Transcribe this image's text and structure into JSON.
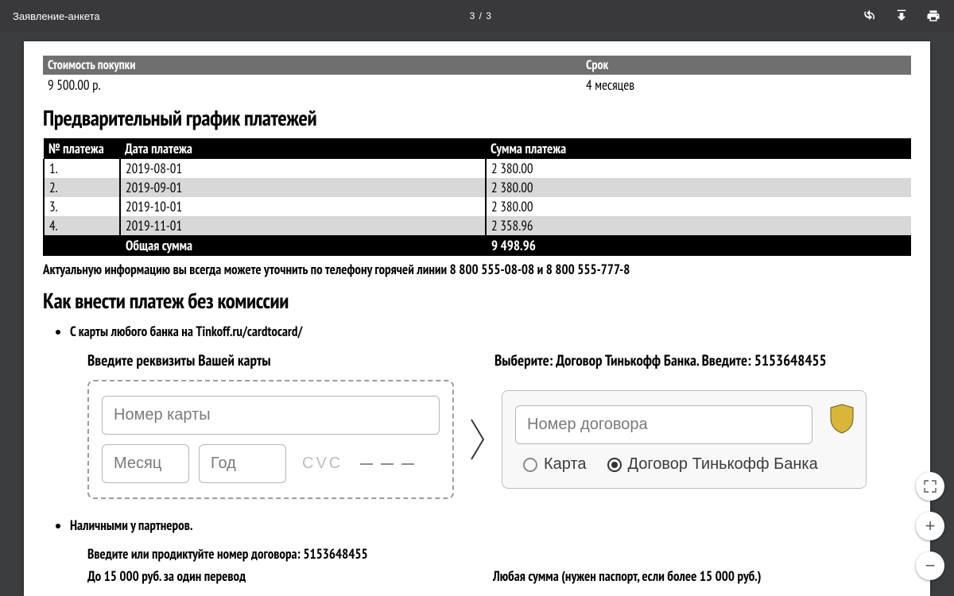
{
  "toolbar": {
    "title": "Заявление-анкета",
    "page_indicator": "3 / 3"
  },
  "purchase": {
    "cost_label": "Стоимость покупки",
    "cost_value": "9 500.00 р.",
    "term_label": "Срок",
    "term_value": "4 месяцев"
  },
  "schedule": {
    "heading": "Предварительный график платежей",
    "col_num": "№ платежа",
    "col_date": "Дата платежа",
    "col_amount": "Сумма платежа",
    "rows": [
      {
        "n": "1.",
        "date": "2019-08-01",
        "amt": "2 380.00"
      },
      {
        "n": "2.",
        "date": "2019-09-01",
        "amt": "2 380.00"
      },
      {
        "n": "3.",
        "date": "2019-10-01",
        "amt": "2 380.00"
      },
      {
        "n": "4.",
        "date": "2019-11-01",
        "amt": "2 358.96"
      }
    ],
    "total_label": "Общая сумма",
    "total_value": "9 498.96"
  },
  "hotline_note": "Актуальную информацию вы всегда можете уточнить по телефону горячей линии 8 800 555-08-08 и 8 800 555-777-8",
  "howto_heading": "Как внести платеж без комиссии",
  "method1": {
    "title": "С карты любого банка на Tinkoff.ru/cardtocard/",
    "left_caption": "Введите реквизиты Вашей карты",
    "right_caption": "Выберите: Договор Тинькофф Банка. Введите: 5153648455",
    "card_number_ph": "Номер карты",
    "month_ph": "Месяц",
    "year_ph": "Год",
    "cvc_label": "CVC",
    "contract_ph": "Номер договора",
    "radio_card": "Карта",
    "radio_contract": "Договор Тинькофф Банка"
  },
  "method2": {
    "title": "Наличными у партнеров.",
    "instruction": "Введите или продиктуйте номер договора: 5153648455",
    "left_note": "До 15 000 руб. за один перевод",
    "right_note": "Любая сумма (нужен паспорт, если более 15 000 руб.)"
  }
}
